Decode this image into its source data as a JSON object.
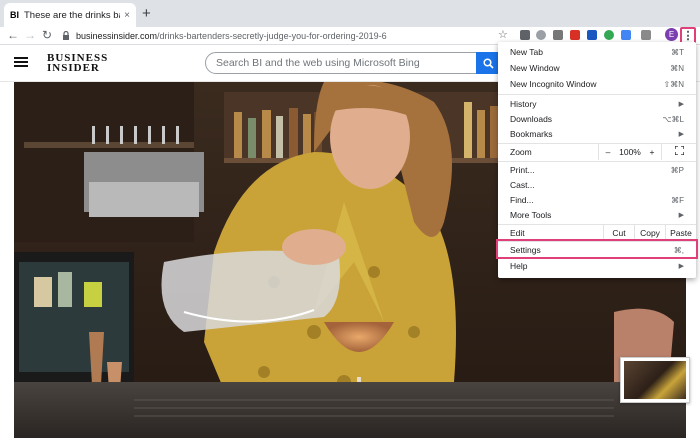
{
  "tab": {
    "favicon": "BI",
    "title": "These are the drinks bartenders",
    "close": "×"
  },
  "new_tab_symbol": "+",
  "toolbar": {
    "back": "←",
    "forward": "→",
    "reload": "↻",
    "url_host": "businessinsider.com",
    "url_path": "/drinks-bartenders-secretly-judge-you-for-ordering-2019-6",
    "star": "☆",
    "profile_initial": "E",
    "menu": "⋮"
  },
  "site": {
    "logo_line1": "BUSINESS",
    "logo_line2": "INSIDER",
    "search_placeholder": "Search BI and the web using Microsoft Bing"
  },
  "menu": {
    "new_tab": "New Tab",
    "new_tab_sc": "⌘T",
    "new_window": "New Window",
    "new_window_sc": "⌘N",
    "new_incognito": "New Incognito Window",
    "new_incognito_sc": "⇧⌘N",
    "history": "History",
    "downloads": "Downloads",
    "downloads_sc": "⌥⌘L",
    "bookmarks": "Bookmarks",
    "zoom": "Zoom",
    "zoom_minus": "–",
    "zoom_value": "100%",
    "zoom_plus": "+",
    "print": "Print...",
    "print_sc": "⌘P",
    "cast": "Cast...",
    "find": "Find...",
    "find_sc": "⌘F",
    "more_tools": "More Tools",
    "edit": "Edit",
    "cut": "Cut",
    "copy": "Copy",
    "paste": "Paste",
    "settings": "Settings",
    "settings_sc": "⌘,",
    "help": "Help",
    "arrow": "▶"
  },
  "colors": {
    "highlight": "#e0407a",
    "bing_blue": "#1a73e8",
    "profile": "#7b3fb0"
  }
}
